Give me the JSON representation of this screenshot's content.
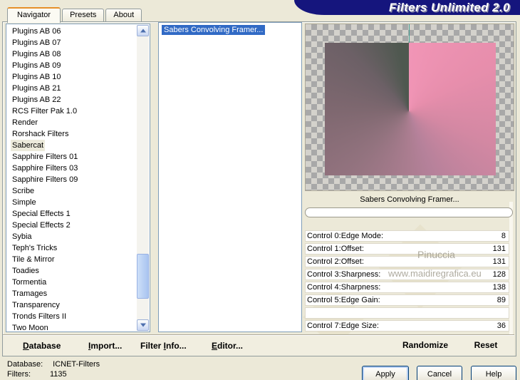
{
  "window": {
    "title": "Filters Unlimited 2.0"
  },
  "tabs": [
    {
      "label": "Navigator",
      "active": true
    },
    {
      "label": "Presets",
      "active": false
    },
    {
      "label": "About",
      "active": false
    }
  ],
  "navigator_list": {
    "items": [
      "Plugins AB 06",
      "Plugins AB 07",
      "Plugins AB 08",
      "Plugins AB 09",
      "Plugins AB 10",
      "Plugins AB 21",
      "Plugins AB 22",
      "RCS Filter Pak 1.0",
      "Render",
      "Rorshack Filters",
      "Sabercat",
      "Sapphire Filters 01",
      "Sapphire Filters 03",
      "Sapphire Filters 09",
      "Scribe",
      "Simple",
      "Special Effects 1",
      "Special Effects 2",
      "Sybia",
      "Teph's Tricks",
      "Tile & Mirror",
      "Toadies",
      "Tormentia",
      "Tramages",
      "Transparency",
      "Tronds Filters II",
      "Two Moon"
    ],
    "selected": "Sabercat"
  },
  "filter_list": {
    "items": [
      "Sabers Convolving Framer..."
    ],
    "selected": "Sabers Convolving Framer..."
  },
  "preview": {
    "caption": "Sabers Convolving Framer..."
  },
  "controls": [
    {
      "label": "Control 0:Edge Mode:",
      "value": "8"
    },
    {
      "label": "Control 1:Offset:",
      "value": "131"
    },
    {
      "label": "Control 2:Offset:",
      "value": "131"
    },
    {
      "label": "Control 3:Sharpness:",
      "value": "128"
    },
    {
      "label": "Control 4:Sharpness:",
      "value": "138"
    },
    {
      "label": "Control 5:Edge Gain:",
      "value": "89"
    },
    {
      "label": "",
      "value": ""
    },
    {
      "label": "Control 7:Edge Size:",
      "value": "36"
    }
  ],
  "watermark": {
    "line1": "Pinuccia",
    "line2": "www.maidiregrafica.eu"
  },
  "actions": {
    "randomize": "Randomize",
    "reset": "Reset"
  },
  "toolbar": [
    {
      "name": "database",
      "label": "Database",
      "underline": "D"
    },
    {
      "name": "import",
      "label": "Import...",
      "underline": "I"
    },
    {
      "name": "filter-info",
      "label": "Filter Info...",
      "underline": "I"
    },
    {
      "name": "editor",
      "label": "Editor...",
      "underline": "E"
    }
  ],
  "status": {
    "database_label": "Database:",
    "database_value": "ICNET-Filters",
    "filters_label": "Filters:",
    "filters_value": "1135"
  },
  "buttons": [
    {
      "name": "apply",
      "label": "Apply",
      "default": true
    },
    {
      "name": "cancel",
      "label": "Cancel",
      "default": false
    },
    {
      "name": "help",
      "label": "Help",
      "default": false
    }
  ],
  "colors": {
    "dialog_bg": "#ece9d8",
    "banner": "#15157d",
    "selection_blue": "#316ac5",
    "inactive_selection": "#eceadb",
    "checker_light": "#d4d2cc",
    "checker_dark": "#a8a8a8",
    "preview_pink": "#f195b6",
    "preview_dark_green": "#4e584f",
    "preview_mauve": "#b17f93",
    "tab_accent_orange": "#e6902a"
  }
}
